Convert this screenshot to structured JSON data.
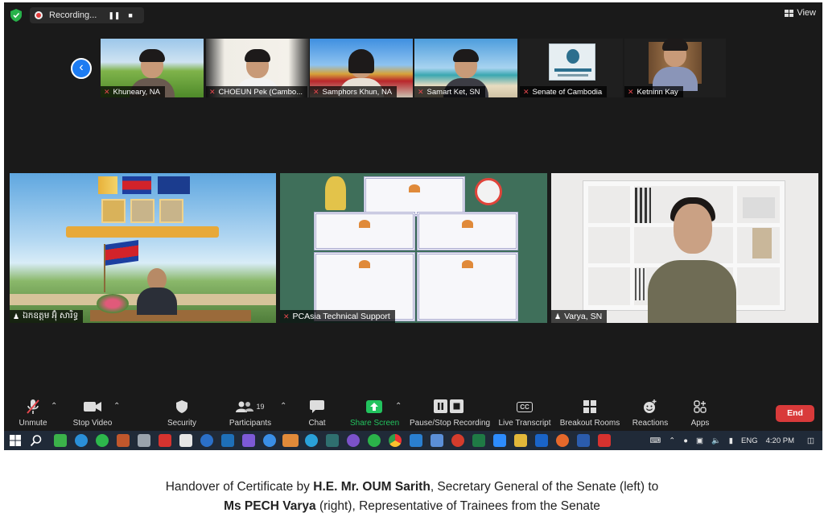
{
  "recording": {
    "label": "Recording..."
  },
  "view": {
    "label": "View"
  },
  "gallery": [
    {
      "name": "Khuneary, NA"
    },
    {
      "name": "CHOEUN Pek (Cambo..."
    },
    {
      "name": "Samphors Khun, NA"
    },
    {
      "name": "Samart Ket, SN"
    },
    {
      "name": "Senate of Cambodia"
    },
    {
      "name": "Ketninn Kay"
    }
  ],
  "main": [
    {
      "name": "ឯកឧត្តម អ៊ុំ សារិទ្ធ"
    },
    {
      "name": "PCAsia Technical Support"
    },
    {
      "name": "Varya, SN"
    }
  ],
  "toolbar": {
    "unmute": "Unmute",
    "stop_video": "Stop Video",
    "security": "Security",
    "participants": "Participants",
    "participants_count": "19",
    "chat": "Chat",
    "share_screen": "Share Screen",
    "pause_stop": "Pause/Stop Recording",
    "live_transcript": "Live Transcript",
    "live_transcript_icon": "CC",
    "breakout": "Breakout Rooms",
    "reactions": "Reactions",
    "apps": "Apps",
    "end": "End"
  },
  "taskbar": {
    "lang": "ENG",
    "time": "4:20 PM"
  },
  "caption": {
    "l1_a": "Handover of Certificate by ",
    "l1_b": "H.E. Mr. OUM Sarith",
    "l1_c": ", Secretary General of the Senate (left) to",
    "l2_a": "Ms PECH Varya",
    "l2_b": " (right), Representative of Trainees from the Senate"
  },
  "colors": {
    "zoom_bg": "#1a1a1a",
    "end_red": "#d93a3a",
    "share_green": "#22c35e",
    "nav_blue": "#1d7cf2",
    "taskbar": "#202a38"
  }
}
